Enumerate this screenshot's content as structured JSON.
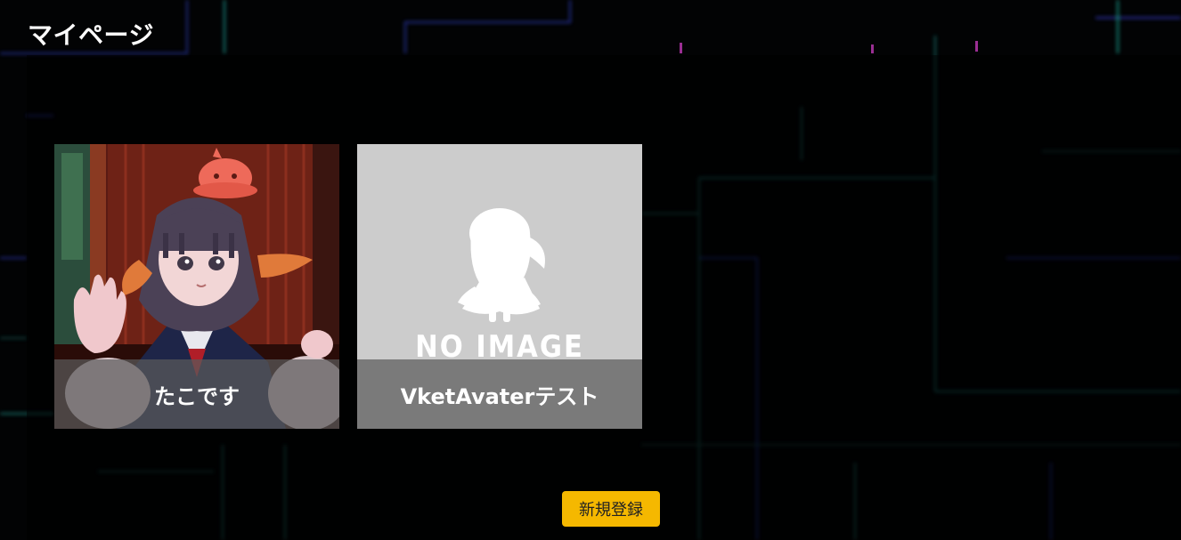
{
  "header": {
    "title": "マイページ"
  },
  "avatars": [
    {
      "name": "たこです",
      "thumbnail": "avatar-girl-photo"
    },
    {
      "name": "VketAvaterテスト",
      "thumbnail": "no-image-placeholder",
      "placeholder_text": "NO IMAGE"
    }
  ],
  "actions": {
    "new_register_label": "新規登録"
  },
  "colors": {
    "background": "#020304",
    "accent_button": "#f5b800",
    "caption_overlay": "#5a5a5a"
  }
}
